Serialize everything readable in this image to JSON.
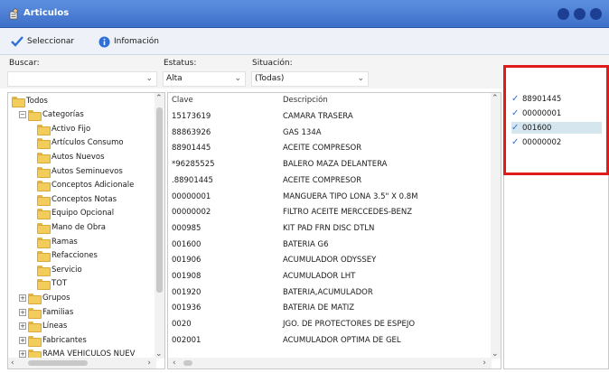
{
  "window": {
    "title": "Articulos",
    "app_icon": "person-list-icon",
    "control_dots": 3,
    "accent_color": "#3e6fc9"
  },
  "toolbar": {
    "select_label": "Seleccionar",
    "select_icon": "check-icon",
    "info_label": "Infomación",
    "info_icon": "info-icon"
  },
  "filters": {
    "search_label": "Buscar:",
    "search_value": "",
    "status_label": "Estatus:",
    "status_value": "Alta",
    "situation_label": "Situación:",
    "situation_value": "(Todas)"
  },
  "tree": {
    "items": [
      {
        "label": "Todos",
        "level": 0,
        "expander": ""
      },
      {
        "label": "Categorías",
        "level": 1,
        "expander": "−"
      },
      {
        "label": "Activo Fijo",
        "level": 2,
        "expander": ""
      },
      {
        "label": "Artículos Consumo",
        "level": 2,
        "expander": ""
      },
      {
        "label": "Autos Nuevos",
        "level": 2,
        "expander": ""
      },
      {
        "label": "Autos Seminuevos",
        "level": 2,
        "expander": ""
      },
      {
        "label": "Conceptos Adicionale",
        "level": 2,
        "expander": ""
      },
      {
        "label": "Conceptos Notas",
        "level": 2,
        "expander": ""
      },
      {
        "label": "Equipo Opcional",
        "level": 2,
        "expander": ""
      },
      {
        "label": "Mano de Obra",
        "level": 2,
        "expander": ""
      },
      {
        "label": "Ramas",
        "level": 2,
        "expander": ""
      },
      {
        "label": "Refacciones",
        "level": 2,
        "expander": ""
      },
      {
        "label": "Servicio",
        "level": 2,
        "expander": ""
      },
      {
        "label": "TOT",
        "level": 2,
        "expander": ""
      },
      {
        "label": "Grupos",
        "level": 1,
        "expander": "+"
      },
      {
        "label": "Familias",
        "level": 1,
        "expander": "+"
      },
      {
        "label": "Líneas",
        "level": 1,
        "expander": "+"
      },
      {
        "label": "Fabricantes",
        "level": 1,
        "expander": "+"
      },
      {
        "label": "RAMA VEHICULOS NUEV",
        "level": 1,
        "expander": "+"
      }
    ]
  },
  "grid": {
    "columns": [
      "Clave",
      "Descripción"
    ],
    "rows": [
      [
        "15173619",
        "CAMARA TRASERA"
      ],
      [
        "88863926",
        "GAS 134A"
      ],
      [
        "88901445",
        "ACEITE COMPRESOR"
      ],
      [
        "*96285525",
        "BALERO MAZA DELANTERA"
      ],
      [
        ".88901445",
        "ACEITE COMPRESOR"
      ],
      [
        "00000001",
        "MANGUERA TIPO LONA 3.5\" X 0.8M"
      ],
      [
        "00000002",
        "FILTRO ACEITE MERCCEDES-BENZ"
      ],
      [
        "000985",
        "KIT PAD FRN DISC DTLN"
      ],
      [
        "001600",
        "BATERIA G6"
      ],
      [
        "001906",
        "ACUMULADOR ODYSSEY"
      ],
      [
        "001908",
        "ACUMULADOR LHT"
      ],
      [
        "001920",
        "BATERIA,ACUMULADOR"
      ],
      [
        "001936",
        "BATERIA DE MATIZ"
      ],
      [
        "0020",
        "JGO. DE PROTECTORES DE ESPEJO"
      ],
      [
        "002001",
        "ACUMULADOR OPTIMA DE GEL"
      ]
    ]
  },
  "selected_list": {
    "items": [
      {
        "code": "88901445",
        "selected": false
      },
      {
        "code": "00000001",
        "selected": false
      },
      {
        "code": "001600",
        "selected": true
      },
      {
        "code": "00000002",
        "selected": false
      }
    ],
    "highlight_color": "#e01b1b"
  }
}
